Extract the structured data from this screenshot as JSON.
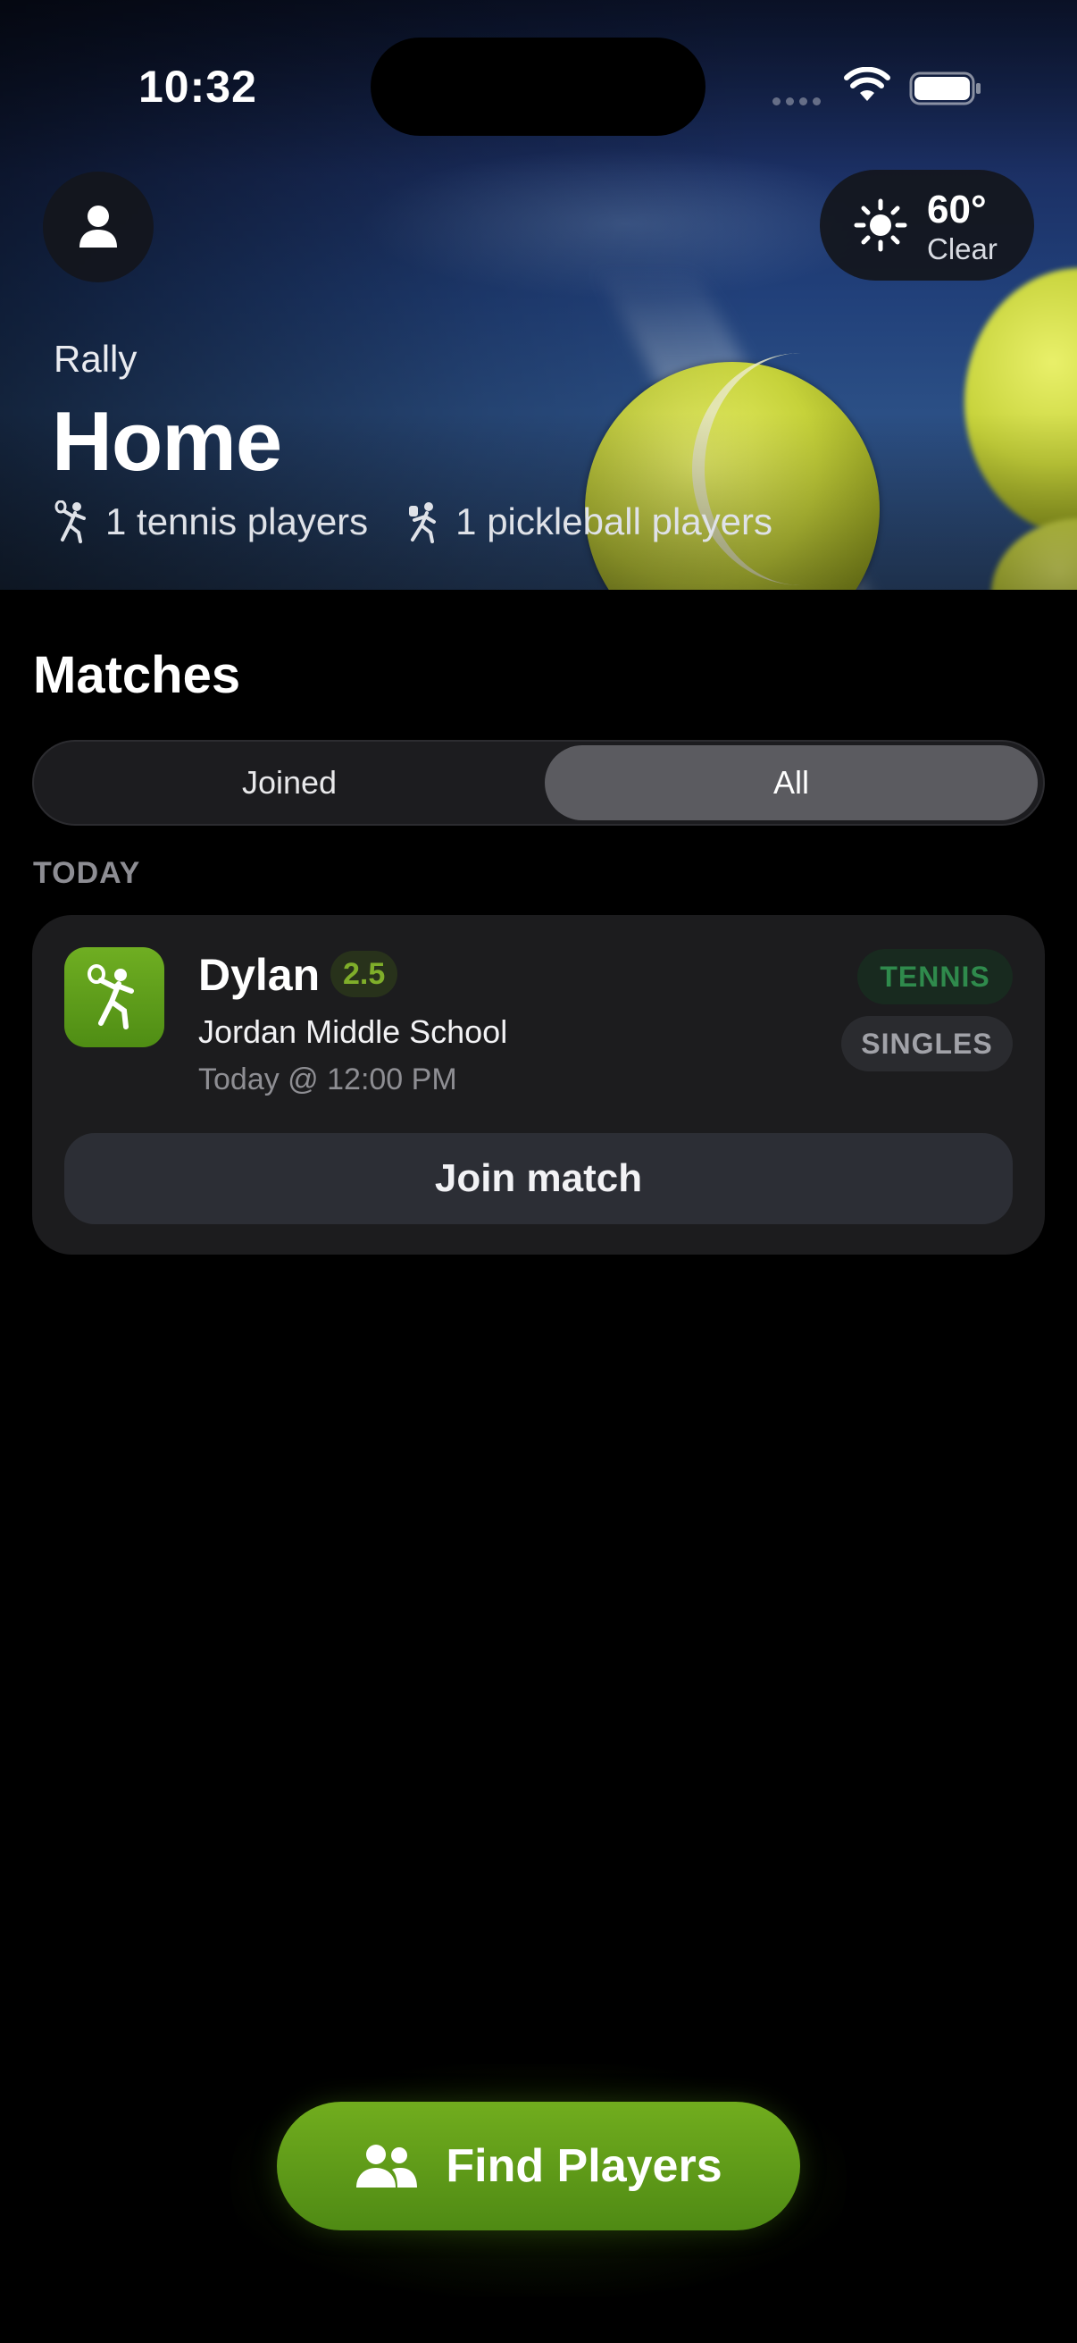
{
  "status_bar": {
    "time": "10:32"
  },
  "header": {
    "app_name": "Rally",
    "title": "Home",
    "tennis_count": "1 tennis players",
    "pickleball_count": "1 pickleball players"
  },
  "weather": {
    "temp": "60°",
    "condition": "Clear",
    "icon": "sun-icon"
  },
  "matches": {
    "section_title": "Matches",
    "tabs": [
      {
        "label": "Joined",
        "selected": false
      },
      {
        "label": "All",
        "selected": true
      }
    ],
    "day_header": "TODAY",
    "items": [
      {
        "player": "Dylan",
        "rating": "2.5",
        "venue": "Jordan Middle School",
        "time": "Today @ 12:00 PM",
        "sport_tag": "TENNIS",
        "format_tag": "SINGLES",
        "action": "Join match"
      }
    ]
  },
  "fab": {
    "label": "Find Players"
  },
  "colors": {
    "accent_green": "#5f9b18",
    "background": "#000000",
    "card": "#1c1c1e"
  }
}
